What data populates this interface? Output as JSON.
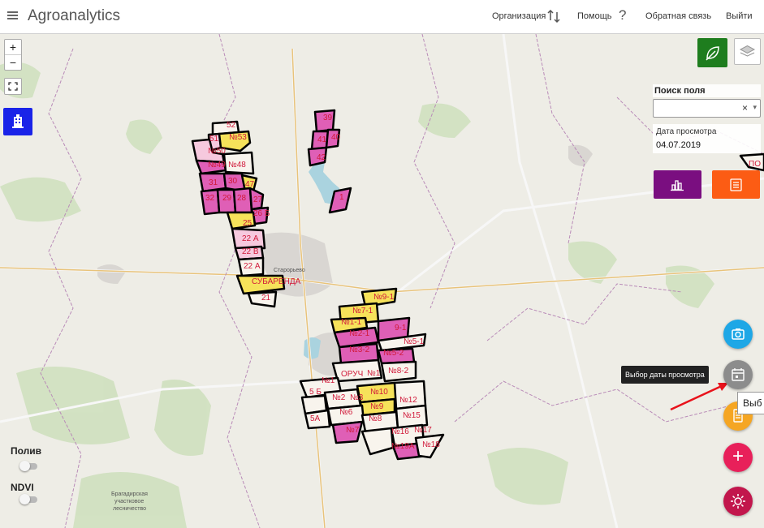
{
  "app": {
    "title": "Agroanalytics"
  },
  "nav": {
    "org": "Организация",
    "help": "Помощь",
    "help_icon": "?",
    "feedback": "Обратная связь",
    "logout": "Выйти"
  },
  "zoom": {
    "in": "+",
    "out": "−"
  },
  "search": {
    "label": "Поиск поля",
    "clear": "×",
    "arrow": "▾"
  },
  "date": {
    "label": "Дата просмотра",
    "value": "04.07.2019"
  },
  "tooltip": {
    "text": "Выбор даты просмотра",
    "partial": "Выб"
  },
  "toggles": {
    "poliv": "Полив",
    "ndvi": "NDVI"
  },
  "fab": {
    "add": "+"
  },
  "map": {
    "town_label": "Старорьево",
    "forest_label_1": "Брагадирская",
    "forest_label_2": "участковое",
    "forest_label_3": "лесничество",
    "field_labels": [
      "52",
      "51",
      "№53",
      "№50",
      "№49",
      "№48",
      "31",
      "30",
      "47",
      "32",
      "29",
      "28",
      "27",
      "26 Б",
      "25",
      "22 А",
      "22 В",
      "22 А",
      "СУБАРЕНДА",
      "21",
      "39",
      "41",
      "40",
      "42",
      "1",
      "№9-1",
      "№7-1",
      "№1-1",
      "№2-1",
      "9-1",
      "№5-1",
      "№3-2",
      "№5-2",
      "ОРУЧ",
      "№1",
      "№8-2",
      "№1",
      "5 Б",
      "№2",
      "№3",
      "№10",
      "№9",
      "№12",
      "№6",
      "№15",
      "5А",
      "№8",
      "№7",
      "№16",
      "№17",
      "№19А",
      "№18",
      "ПО"
    ]
  },
  "colors": {
    "accent_green": "#1e7d1e",
    "blue": "#1a23e8",
    "purple": "#7a0e80",
    "orange": "#fc5c14",
    "field_pink": "#df5fb6",
    "field_yellow": "#f6e25a",
    "fab_blue": "#1ea7e6",
    "fab_grey": "#8c8c8c",
    "fab_orange": "#f5a623",
    "fab_pink": "#e8205a",
    "fab_crimson": "#c2164c"
  },
  "icons": {
    "menu": "menu-icon",
    "org": "sync-icon",
    "leaf": "leaf-icon",
    "layers": "layers-icon",
    "building": "building-icon",
    "chart": "bar-chart-icon",
    "report": "document-icon",
    "camera": "camera-icon",
    "calendar": "calendar-icon",
    "notes": "notepad-icon",
    "settings": "gear-icon",
    "fullscreen": "fullscreen-icon"
  }
}
